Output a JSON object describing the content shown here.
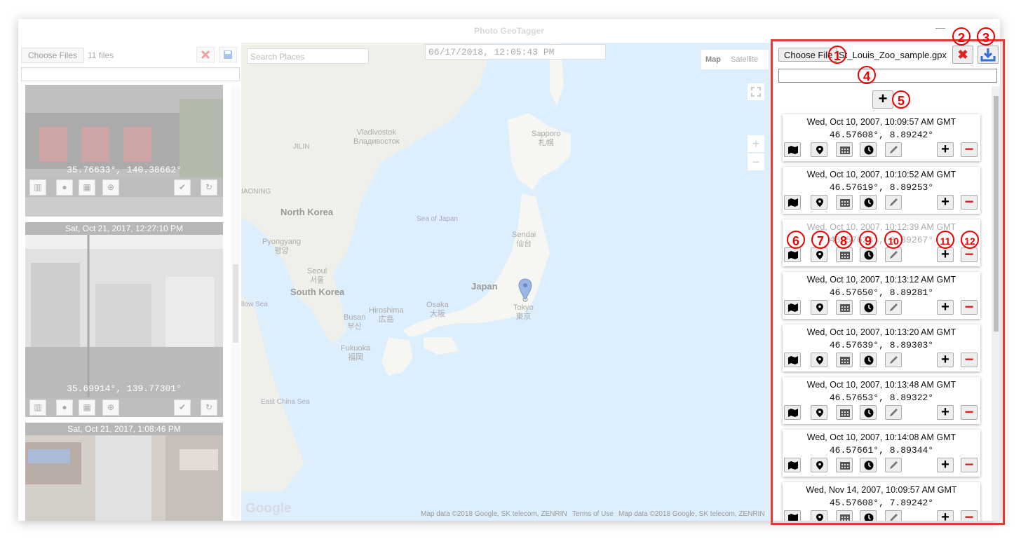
{
  "window": {
    "title": "Photo GeoTagger",
    "minimize": "—"
  },
  "left_panel": {
    "choose_files_label": "Choose Files",
    "file_count": "11 files",
    "photos": [
      {
        "date": "",
        "coords": "35.76633°, 140.38662°"
      },
      {
        "date": "Sat, Oct 21, 2017, 12:27:10 PM",
        "coords": "35.69914°, 139.77301°"
      },
      {
        "date": "Sat, Oct 21, 2017, 1:08:46 PM",
        "coords": ""
      }
    ]
  },
  "map": {
    "search_placeholder": "Search Places",
    "datetime": "06/17/2018, 12:05:43 PM",
    "type_map": "Map",
    "type_satellite": "Satellite",
    "zoom_in": "+",
    "zoom_out": "−",
    "labels": {
      "vladivostok": "Vladivostok",
      "vladivostok_ru": "Владивосток",
      "sapporo": "Sapporo",
      "sapporo_jp": "札幌",
      "jilin": "JILIN",
      "liaoning": "IAONING",
      "north_korea": "North Korea",
      "sea_of_japan": "Sea of Japan",
      "pyongyang": "Pyongyang",
      "pyongyang_kr": "평양",
      "sendai": "Sendai",
      "sendai_jp": "仙台",
      "seoul": "Seoul",
      "seoul_kr": "서울",
      "south_korea": "South Korea",
      "japan": "Japan",
      "yellow_sea": "llow Sea",
      "hiroshima": "Hiroshima",
      "hiroshima_jp": "広島",
      "osaka": "Osaka",
      "osaka_jp": "大阪",
      "tokyo": "Tokyo",
      "tokyo_jp": "東京",
      "busan": "Busan",
      "busan_kr": "부산",
      "fukuoka": "Fukuoka",
      "fukuoka_jp": "福岡",
      "east_china_sea": "East China Sea"
    },
    "google_logo": "Google",
    "attribution_1": "Map data ©2018 Google, SK telecom, ZENRIN",
    "terms": "Terms of Use",
    "attribution_2": "Map data ©2018 Google, SK telecom, ZENRIN"
  },
  "right_panel": {
    "choose_file_label": "Choose File",
    "filename": "St_Louis_Zoo_sample.gpx",
    "clear_symbol": "✖",
    "add_symbol": "+",
    "trackpoints": [
      {
        "date": "Wed, Oct 10, 2007, 10:09:57 AM GMT",
        "coords": "46.57608°, 8.89242°"
      },
      {
        "date": "Wed, Oct 10, 2007, 10:10:52 AM GMT",
        "coords": "46.57619°, 8.89253°"
      },
      {
        "date": "Wed, Oct 10, 2007, 10:12:39 AM GMT",
        "coords": "46.57628°, 8.89267°"
      },
      {
        "date": "Wed, Oct 10, 2007, 10:13:12 AM GMT",
        "coords": "46.57650°, 8.89281°"
      },
      {
        "date": "Wed, Oct 10, 2007, 10:13:20 AM GMT",
        "coords": "46.57639°, 8.89303°"
      },
      {
        "date": "Wed, Oct 10, 2007, 10:13:48 AM GMT",
        "coords": "46.57653°, 8.89322°"
      },
      {
        "date": "Wed, Oct 10, 2007, 10:14:08 AM GMT",
        "coords": "46.57661°, 8.89344°"
      },
      {
        "date": "Wed, Nov 14, 2007, 10:09:57 AM GMT",
        "coords": "45.57608°, 7.89242°"
      }
    ],
    "plus_label": "+",
    "minus_label": "−"
  },
  "annotations": [
    "1",
    "2",
    "3",
    "4",
    "5",
    "6",
    "7",
    "8",
    "9",
    "10",
    "11",
    "12"
  ],
  "colors": {
    "highlight": "#e53935",
    "delete_red": "#e02020",
    "download_blue": "#2f6fd6"
  }
}
